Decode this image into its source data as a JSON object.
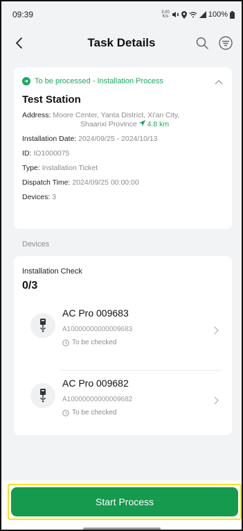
{
  "status_bar": {
    "time": "09:39",
    "net_speed_top": "3.00",
    "net_speed_bottom": "K/s",
    "battery": "100%"
  },
  "header": {
    "title": "Task Details"
  },
  "task": {
    "status": "To be processed - Installation Process",
    "station_name": "Test Station",
    "address_label": "Address:",
    "address_line1": "Moore Center, Yanta District, Xi'an City,",
    "address_line2": "Shaanxi Province",
    "distance": "4.8 km",
    "installation_date_label": "Installation Date:",
    "installation_date": "2024/09/25 - 2024/10/13",
    "id_label": "ID:",
    "id": "IO1000075",
    "type_label": "Type:",
    "type": "Installation Ticket",
    "dispatch_label": "Dispatch Time:",
    "dispatch_time": "2024/09/25 00:00:00",
    "devices_label": "Devices:",
    "devices_count": "3"
  },
  "devices_section": {
    "label": "Devices",
    "check_label": "Installation Check",
    "check_count": "0/3",
    "items": [
      {
        "name": "AC Pro 009683",
        "serial": "A10000000000009683",
        "state": "To be checked"
      },
      {
        "name": "AC Pro 009682",
        "serial": "A10000000000009682",
        "state": "To be checked"
      }
    ]
  },
  "actions": {
    "start_label": "Start Process"
  },
  "colors": {
    "accent_green": "#1aa860",
    "button_green": "#169a4d",
    "highlight": "#f5e21c"
  }
}
